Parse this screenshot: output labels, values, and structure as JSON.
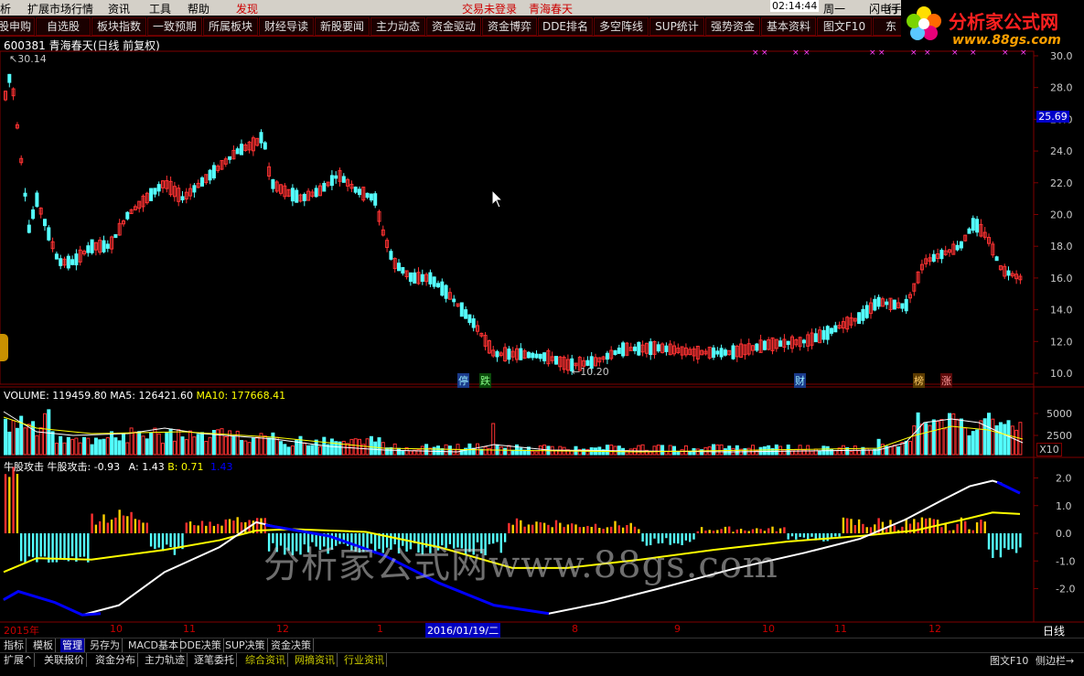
{
  "menu": {
    "items": [
      "析",
      "扩展市场行情",
      "资讯",
      "工具",
      "帮助",
      "发现"
    ],
    "login_status": "交易未登录",
    "stock_name": "青海春天",
    "time": "02:14:44",
    "weekday": "周一",
    "flash_label": "闪电手",
    "trade_label": "行"
  },
  "nav_tabs": [
    "股申购",
    "自选股",
    "板块指数",
    "一致预期",
    "所属板块",
    "财经导读",
    "新股要闻",
    "主力动态",
    "资金驱动",
    "资金博弈",
    "DDE排名",
    "多空阵线",
    "SUP统计",
    "强势资金",
    "基本资料",
    "图文F10",
    "东"
  ],
  "logo": {
    "title": "分析家公式网",
    "url": "www.88gs.com"
  },
  "chart_header": {
    "code": "600381",
    "name": "青海春天",
    "period": "(日线 前复权)"
  },
  "price_panel": {
    "high_label": "30.14",
    "low_label": "10.20",
    "current_price": "25.69",
    "yticks": [
      "30.0",
      "28.0",
      "26.0",
      "24.0",
      "22.0",
      "20.0",
      "18.0",
      "16.0",
      "14.0",
      "12.0",
      "10.0"
    ],
    "event_tags": [
      "停",
      "跌",
      "财",
      "榜",
      "涨"
    ]
  },
  "volume_panel": {
    "label": "VOLUME: 119459.80",
    "ma5": "MA5: 126421.60",
    "ma10": "MA10: 177668.41",
    "yticks": [
      "5000",
      "2500"
    ],
    "unit": "X10"
  },
  "indicator_panel": {
    "name": "牛股攻击",
    "value": "牛股攻击: -0.93",
    "a": "A: 1.43",
    "b": "B: 0.71",
    "c": "1.43",
    "yticks": [
      "2.0",
      "1.0",
      "0.0",
      "-1.0",
      "-2.0"
    ]
  },
  "watermark": "分析家公式网www.88gs.com",
  "xaxis": {
    "labels": [
      "2015年",
      "10",
      "11",
      "12",
      "1",
      "2016/01/19/二",
      "8",
      "9",
      "10",
      "11",
      "12"
    ],
    "period_button": "日线"
  },
  "bottom_tabs_1": [
    "指标",
    "模板",
    "管理",
    "另存为",
    "MACD基本",
    "DDE决策",
    "SUP决策",
    "资金决策"
  ],
  "bottom_tabs_2": [
    "扩展^",
    "关联报价",
    "资金分布",
    "主力轨迹",
    "逐笔委托",
    "综合资讯",
    "网摘资讯",
    "行业资讯"
  ],
  "bottom_right": {
    "f10": "图文F10",
    "sidebar": "侧边栏"
  },
  "colors": {
    "up": "#ff3232",
    "down": "#54ffff",
    "grid": "#800000",
    "ma5": "#ffffff",
    "ma10": "#ffff00",
    "blue": "#0000ff"
  },
  "chart_data": {
    "type": "candlestick",
    "description_series": [
      {
        "name": "牛股攻击"
      }
    ],
    "price_range": [
      10.0,
      30.5
    ],
    "indicator_range": [
      -3.0,
      2.5
    ]
  }
}
